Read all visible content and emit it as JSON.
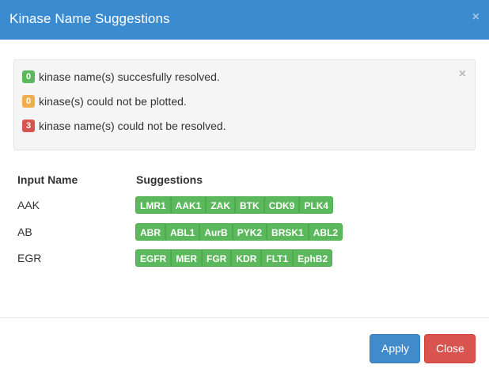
{
  "modal": {
    "title": "Kinase Name Suggestions",
    "close_glyph": "×"
  },
  "alert": {
    "close_glyph": "×",
    "lines": [
      {
        "count": "0",
        "color": "#5cb85c",
        "text": "kinase name(s) succesfully resolved."
      },
      {
        "count": "0",
        "color": "#f0ad4e",
        "text": "kinase(s) could not be plotted."
      },
      {
        "count": "3",
        "color": "#d9534f",
        "text": "kinase name(s) could not be resolved."
      }
    ]
  },
  "table": {
    "headers": {
      "input": "Input Name",
      "suggestions": "Suggestions"
    },
    "rows": [
      {
        "input": "AAK",
        "suggestions": [
          "LMR1",
          "AAK1",
          "ZAK",
          "BTK",
          "CDK9",
          "PLK4"
        ]
      },
      {
        "input": "AB",
        "suggestions": [
          "ABR",
          "ABL1",
          "AurB",
          "PYK2",
          "BRSK1",
          "ABL2"
        ]
      },
      {
        "input": "EGR",
        "suggestions": [
          "EGFR",
          "MER",
          "FGR",
          "KDR",
          "FLT1",
          "EphB2"
        ]
      }
    ]
  },
  "footer": {
    "apply_label": "Apply",
    "close_label": "Close"
  },
  "colors": {
    "header_bg": "#3b8bd1",
    "chip_bg": "#5cb85c",
    "apply_bg": "#428bca",
    "close_bg": "#d9534f"
  }
}
